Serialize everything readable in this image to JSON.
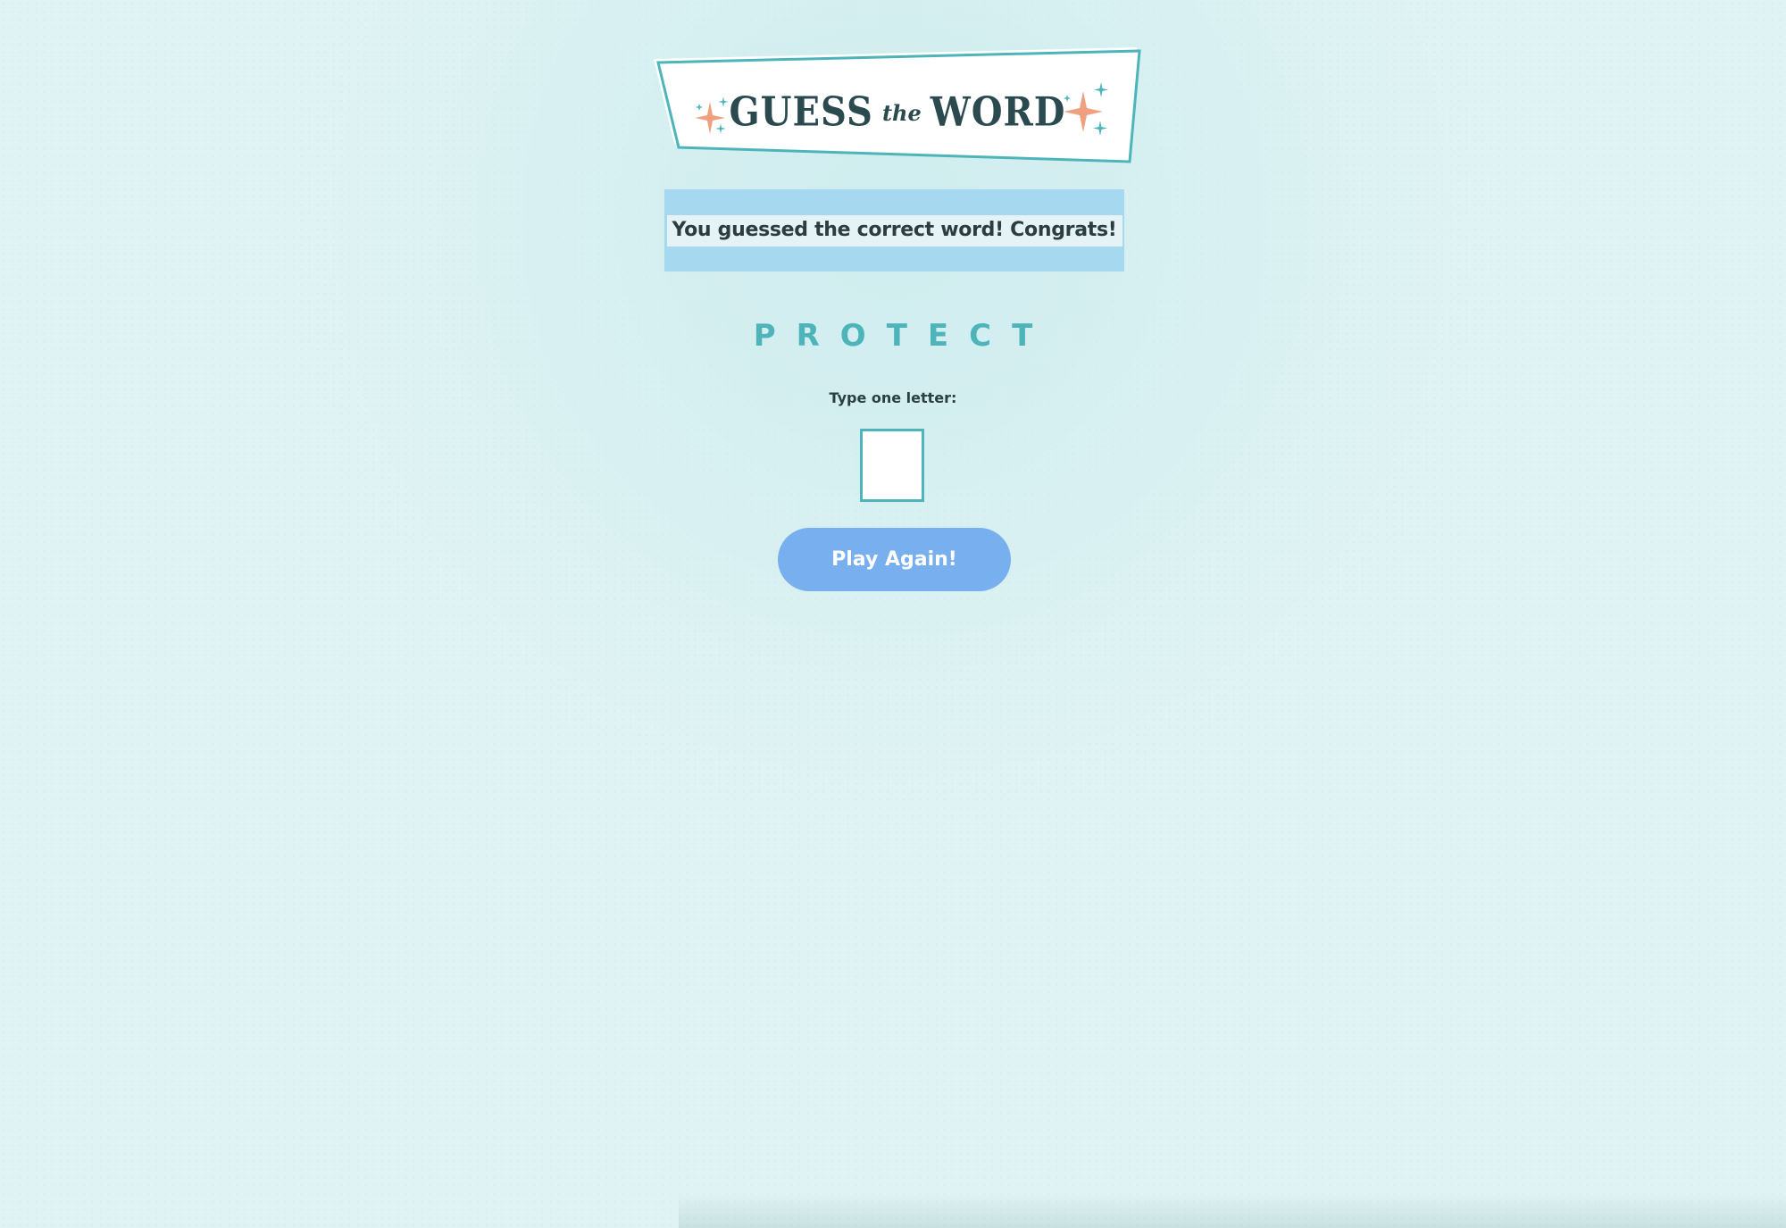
{
  "header": {
    "logo_guess": "GUESS",
    "logo_the": "the",
    "logo_word": "WORD"
  },
  "message": {
    "text": "You guessed the correct word! Congrats!"
  },
  "game": {
    "word_progress": "PROTECT",
    "input_label": "Type one letter:",
    "input_value": "",
    "play_again_label": "Play Again!"
  },
  "colors": {
    "accent_teal": "#4db5ba",
    "logo_text": "#2b4a4f",
    "sparkle_orange": "#f0a07f",
    "message_bg": "#a6d9ef",
    "button_bg": "#78afee",
    "page_bg": "#e0f3f4"
  },
  "icons": {
    "logo_sparkles": "sparkle-icon"
  }
}
